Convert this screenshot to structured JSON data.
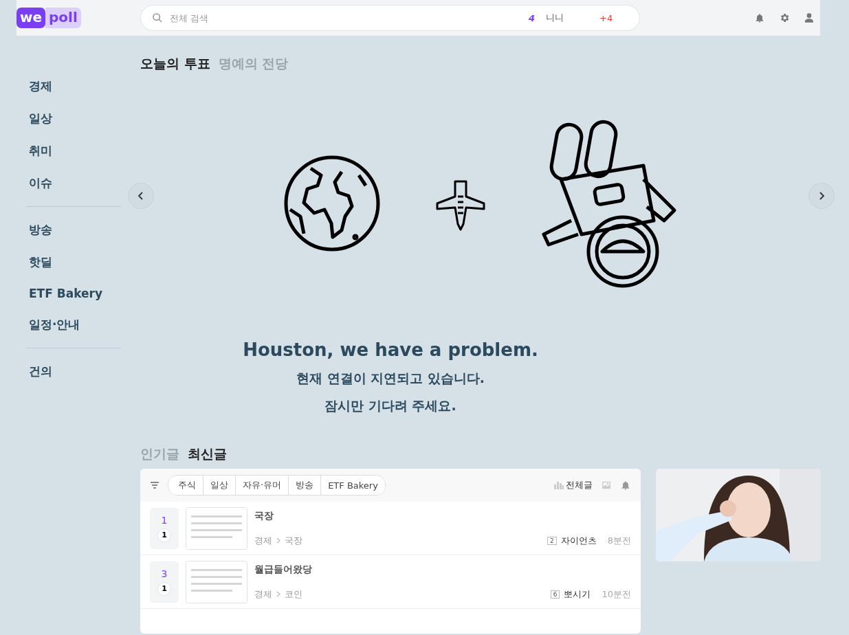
{
  "header": {
    "logo": {
      "first": "we",
      "second": "poll"
    },
    "search": {
      "placeholder": "전체 검색"
    },
    "user": {
      "level": "4",
      "name": "니니",
      "points": "+4"
    }
  },
  "sidebar": {
    "groups": [
      [
        "경제",
        "일상",
        "취미",
        "이슈"
      ],
      [
        "방송",
        "핫딜",
        "ETF Bakery",
        "일정·안내"
      ],
      [
        "건의"
      ]
    ]
  },
  "vote_tabs": [
    {
      "label": "오늘의 투표",
      "selected": true
    },
    {
      "label": "명예의 전당",
      "selected": false
    }
  ],
  "error": {
    "title": "Houston, we have a problem.",
    "lines": [
      "현재 연결이 지연되고 있습니다.",
      "잠시만 기다려 주세요."
    ]
  },
  "post_tabs": [
    {
      "label": "인기글",
      "selected": false
    },
    {
      "label": "최신글",
      "selected": true
    }
  ],
  "filters": [
    "주식",
    "일상",
    "자유·유머",
    "방송",
    "ETF Bakery"
  ],
  "all_posts": "전체글",
  "posts": [
    {
      "votes": "1",
      "comments": "1",
      "title": "국장",
      "category": "경제",
      "subcategory": "국장",
      "author_level": "2",
      "author": "자이언츠",
      "time": "8분전"
    },
    {
      "votes": "3",
      "comments": "1",
      "title": "월급들어왔당",
      "category": "경제",
      "subcategory": "코인",
      "author_level": "6",
      "author": "뽀시기",
      "time": "10분전"
    }
  ]
}
